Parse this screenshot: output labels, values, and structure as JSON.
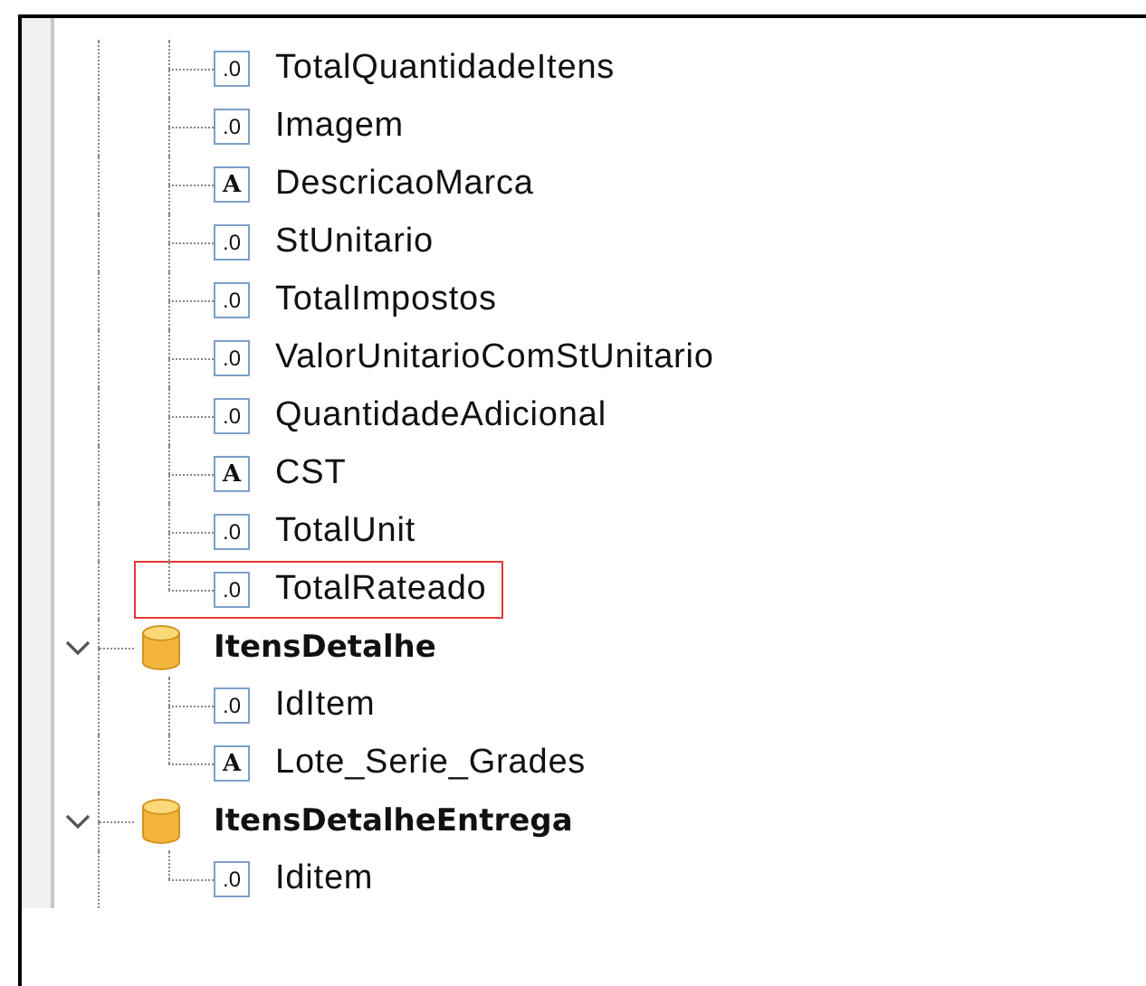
{
  "tree": [
    {
      "kind": "group",
      "children": [
        {
          "label": "TotalQuantidadeItens",
          "icon": ".0",
          "highlighted": false
        },
        {
          "label": "Imagem",
          "icon": ".0",
          "highlighted": false
        },
        {
          "label": "DescricaoMarca",
          "icon": "A",
          "highlighted": false
        },
        {
          "label": "StUnitario",
          "icon": ".0",
          "highlighted": false
        },
        {
          "label": "TotalImpostos",
          "icon": ".0",
          "highlighted": false
        },
        {
          "label": "ValorUnitarioComStUnitario",
          "icon": ".0",
          "highlighted": false
        },
        {
          "label": "QuantidadeAdicional",
          "icon": ".0",
          "highlighted": false
        },
        {
          "label": "CST",
          "icon": "A",
          "highlighted": false
        },
        {
          "label": "TotalUnit",
          "icon": ".0",
          "highlighted": false
        },
        {
          "label": "TotalRateado",
          "icon": ".0",
          "highlighted": true
        }
      ]
    },
    {
      "kind": "table",
      "label": "ItensDetalhe",
      "expanded": true,
      "children": [
        {
          "label": "IdItem",
          "icon": ".0",
          "highlighted": false
        },
        {
          "label": "Lote_Serie_Grades",
          "icon": "A",
          "highlighted": false
        }
      ]
    },
    {
      "kind": "table",
      "label": "ItensDetalheEntrega",
      "expanded": true,
      "children": [
        {
          "label": "Iditem",
          "icon": ".0",
          "highlighted": false
        }
      ]
    }
  ]
}
